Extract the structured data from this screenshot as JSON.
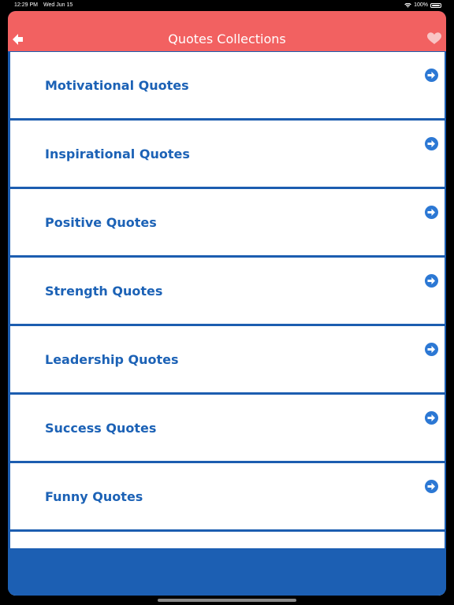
{
  "status": {
    "time": "12:29 PM",
    "date": "Wed Jun 15",
    "battery": "100%"
  },
  "header": {
    "title": "Quotes Collections",
    "back_icon": "back-arrow-icon",
    "favorite_icon": "heart-icon"
  },
  "colors": {
    "header": "#f26161",
    "accent": "#1c62b6",
    "row_bg": "#ffffff"
  },
  "categories": [
    {
      "label": "Motivational Quotes"
    },
    {
      "label": "Inspirational Quotes"
    },
    {
      "label": "Positive Quotes"
    },
    {
      "label": "Strength Quotes"
    },
    {
      "label": "Leadership Quotes"
    },
    {
      "label": "Success Quotes"
    },
    {
      "label": "Funny Quotes"
    },
    {
      "label": ""
    }
  ]
}
